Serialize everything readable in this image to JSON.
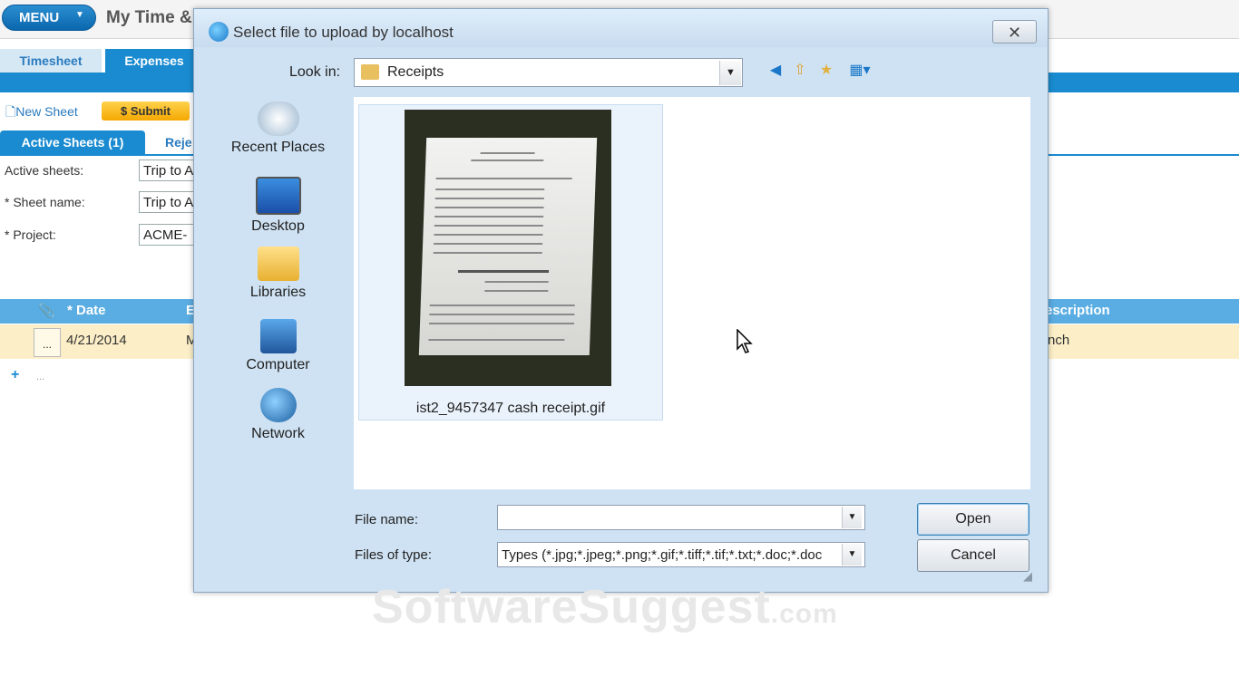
{
  "app": {
    "menu_label": "MENU",
    "title": "My Time &",
    "tabs": [
      "Timesheet",
      "Expenses"
    ],
    "toolbar": {
      "new_sheet": "New Sheet",
      "submit": "Submit"
    },
    "subtabs": {
      "active": "Active Sheets (1)",
      "rejected": "Reje"
    },
    "form": {
      "active_sheets_label": "Active sheets:",
      "active_sheets_value": "Trip to A",
      "sheet_name_label": "* Sheet name:",
      "sheet_name_value": "Trip to A",
      "project_label": "* Project:",
      "project_value": "ACME-"
    },
    "grid": {
      "headers": {
        "date": "* Date",
        "col_e": "E",
        "description": "escription"
      },
      "row": {
        "date": "4/21/2014",
        "col_e": "M",
        "description": "nch",
        "ellipsis": "..."
      },
      "add_icon": "+",
      "add_dots": "..."
    }
  },
  "dialog": {
    "title": "Select file to upload by localhost",
    "close_glyph": "✕",
    "look_in_label": "Look in:",
    "look_in_value": "Receipts",
    "places": [
      "Recent Places",
      "Desktop",
      "Libraries",
      "Computer",
      "Network"
    ],
    "file": {
      "name": "ist2_9457347 cash receipt.gif"
    },
    "file_name_label": "File name:",
    "file_name_value": "",
    "files_of_type_label": "Files of type:",
    "files_of_type_value": "Types (*.jpg;*.jpeg;*.png;*.gif;*.tiff;*.tif;*.txt;*.doc;*.doc",
    "open_label": "Open",
    "cancel_label": "Cancel"
  },
  "watermark": {
    "main": "SoftwareSuggest",
    "suffix": ".com"
  },
  "colors": {
    "brand_blue": "#1a8bd0",
    "grid_header": "#5aade2",
    "row_highlight": "#fcefc8",
    "dialog_frame": "#cfe2f3"
  }
}
